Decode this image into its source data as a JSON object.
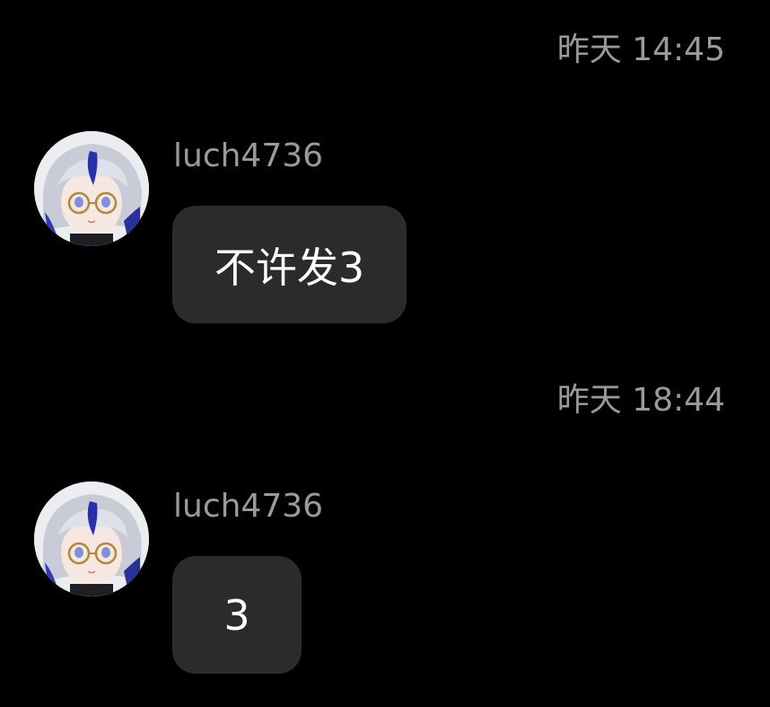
{
  "messages": [
    {
      "timestamp": "昨天 14:45",
      "sender": "luch4736",
      "avatar_icon": "anime-avatar-icon",
      "text": "不许发3"
    },
    {
      "timestamp": "昨天 18:44",
      "sender": "luch4736",
      "avatar_icon": "anime-avatar-icon",
      "text": "3"
    }
  ],
  "colors": {
    "background": "#000000",
    "bubble": "#2b2b2d",
    "meta_text": "#9a9a9a",
    "message_text": "#ffffff"
  }
}
